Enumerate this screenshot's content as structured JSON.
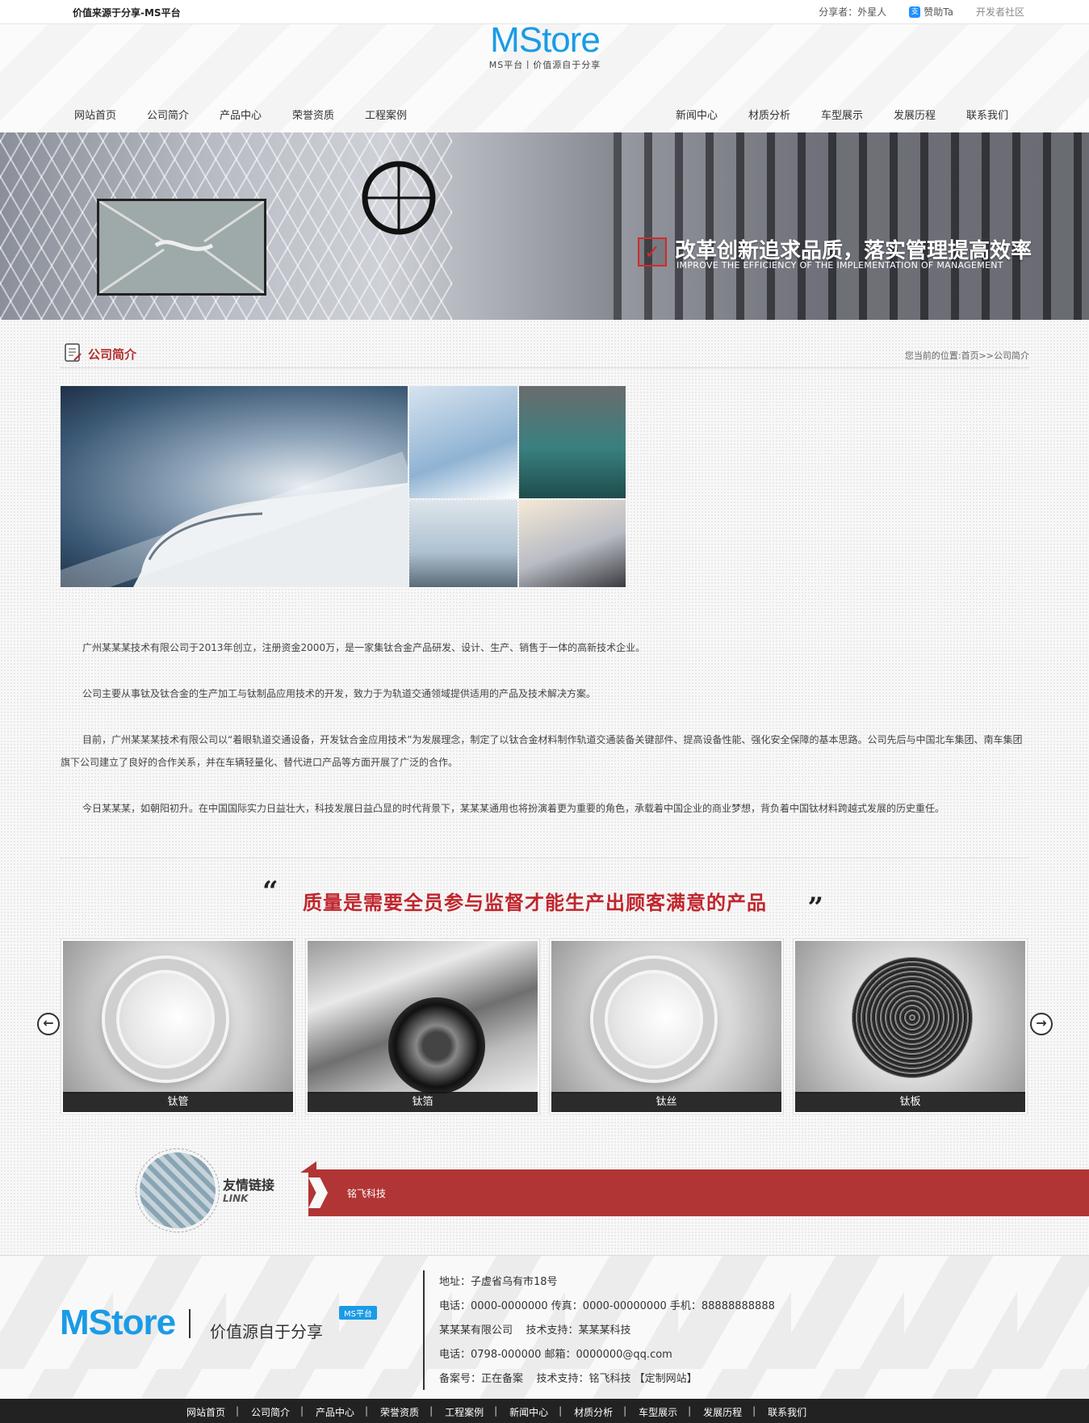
{
  "topbar": {
    "title": "价值来源于分享-MS平台",
    "sharer": "分享者：外星人",
    "sponsor": "赞助Ta",
    "dev_community": "开发者社区"
  },
  "header": {
    "brand": "MStore",
    "tagline": "MS平台丨价值源自于分享",
    "nav_left": [
      "网站首页",
      "公司简介",
      "产品中心",
      "荣誉资质",
      "工程案例"
    ],
    "nav_right": [
      "新闻中心",
      "材质分析",
      "车型展示",
      "发展历程",
      "联系我们"
    ]
  },
  "banner": {
    "slogan_zh": "改革创新追求品质，落实管理提高效率",
    "slogan_en": "IMPROVE THE EFFICIENCY OF THE IMPLEMENTATION OF MANAGEMENT"
  },
  "section": {
    "title": "公司简介",
    "breadcrumb": "您当前的位置:首页>>公司简介"
  },
  "intro": {
    "p1": "广州某某某技术有限公司于2013年创立，注册资金2000万，是一家集钛合金产品研发、设计、生产、销售于一体的高新技术企业。",
    "p2": "公司主要从事钛及钛合金的生产加工与钛制品应用技术的开发，致力于为轨道交通领域提供适用的产品及技术解决方案。",
    "p3": "目前，广州某某某技术有限公司以“着眼轨道交通设备，开发钛合金应用技术”为发展理念，制定了以钛合金材料制作轨道交通装备关键部件、提高设备性能、强化安全保障的基本思路。公司先后与中国北车集团、南车集团旗下公司建立了良好的合作关系，并在车辆轻量化、替代进口产品等方面开展了广泛的合作。",
    "p4": "今日某某某，如朝阳初升。在中国国际实力日益壮大，科技发展日益凸显的时代背景下，某某某通用也将扮演着更为重要的角色，承载着中国企业的商业梦想，背负着中国钛材料跨越式发展的历史重任。"
  },
  "quote": {
    "open": "“",
    "text": "质量是需要全员参与监督才能生产出顾客满意的产品",
    "close": "”"
  },
  "products": [
    {
      "label": "钛管"
    },
    {
      "label": "钛箔"
    },
    {
      "label": "钛丝"
    },
    {
      "label": "钛板"
    }
  ],
  "links": {
    "title": "友情链接",
    "title_en": "LINK",
    "items": [
      "铭飞科技"
    ]
  },
  "footer": {
    "brand": "MStore",
    "slogan": "价值源自于分享",
    "badge": "MS平台",
    "address": "地址：子虚省乌有市18号",
    "phones": "电话：0000-0000000 传真：0000-00000000 手机：88888888888",
    "company": "某某某有限公司    技术支持：某某某科技",
    "contact": "电话：0798-000000 邮箱：0000000@qq.com",
    "icp": "备案号：正在备案    技术支持：铭飞科技 【定制网站】",
    "nav": [
      "网站首页",
      "公司简介",
      "产品中心",
      "荣誉资质",
      "工程案例",
      "新闻中心",
      "材质分析",
      "车型展示",
      "发展历程",
      "联系我们"
    ]
  },
  "colors": {
    "brand_blue": "#1a9be6",
    "accent_red": "#b23535",
    "footer_bar": "#222222"
  }
}
